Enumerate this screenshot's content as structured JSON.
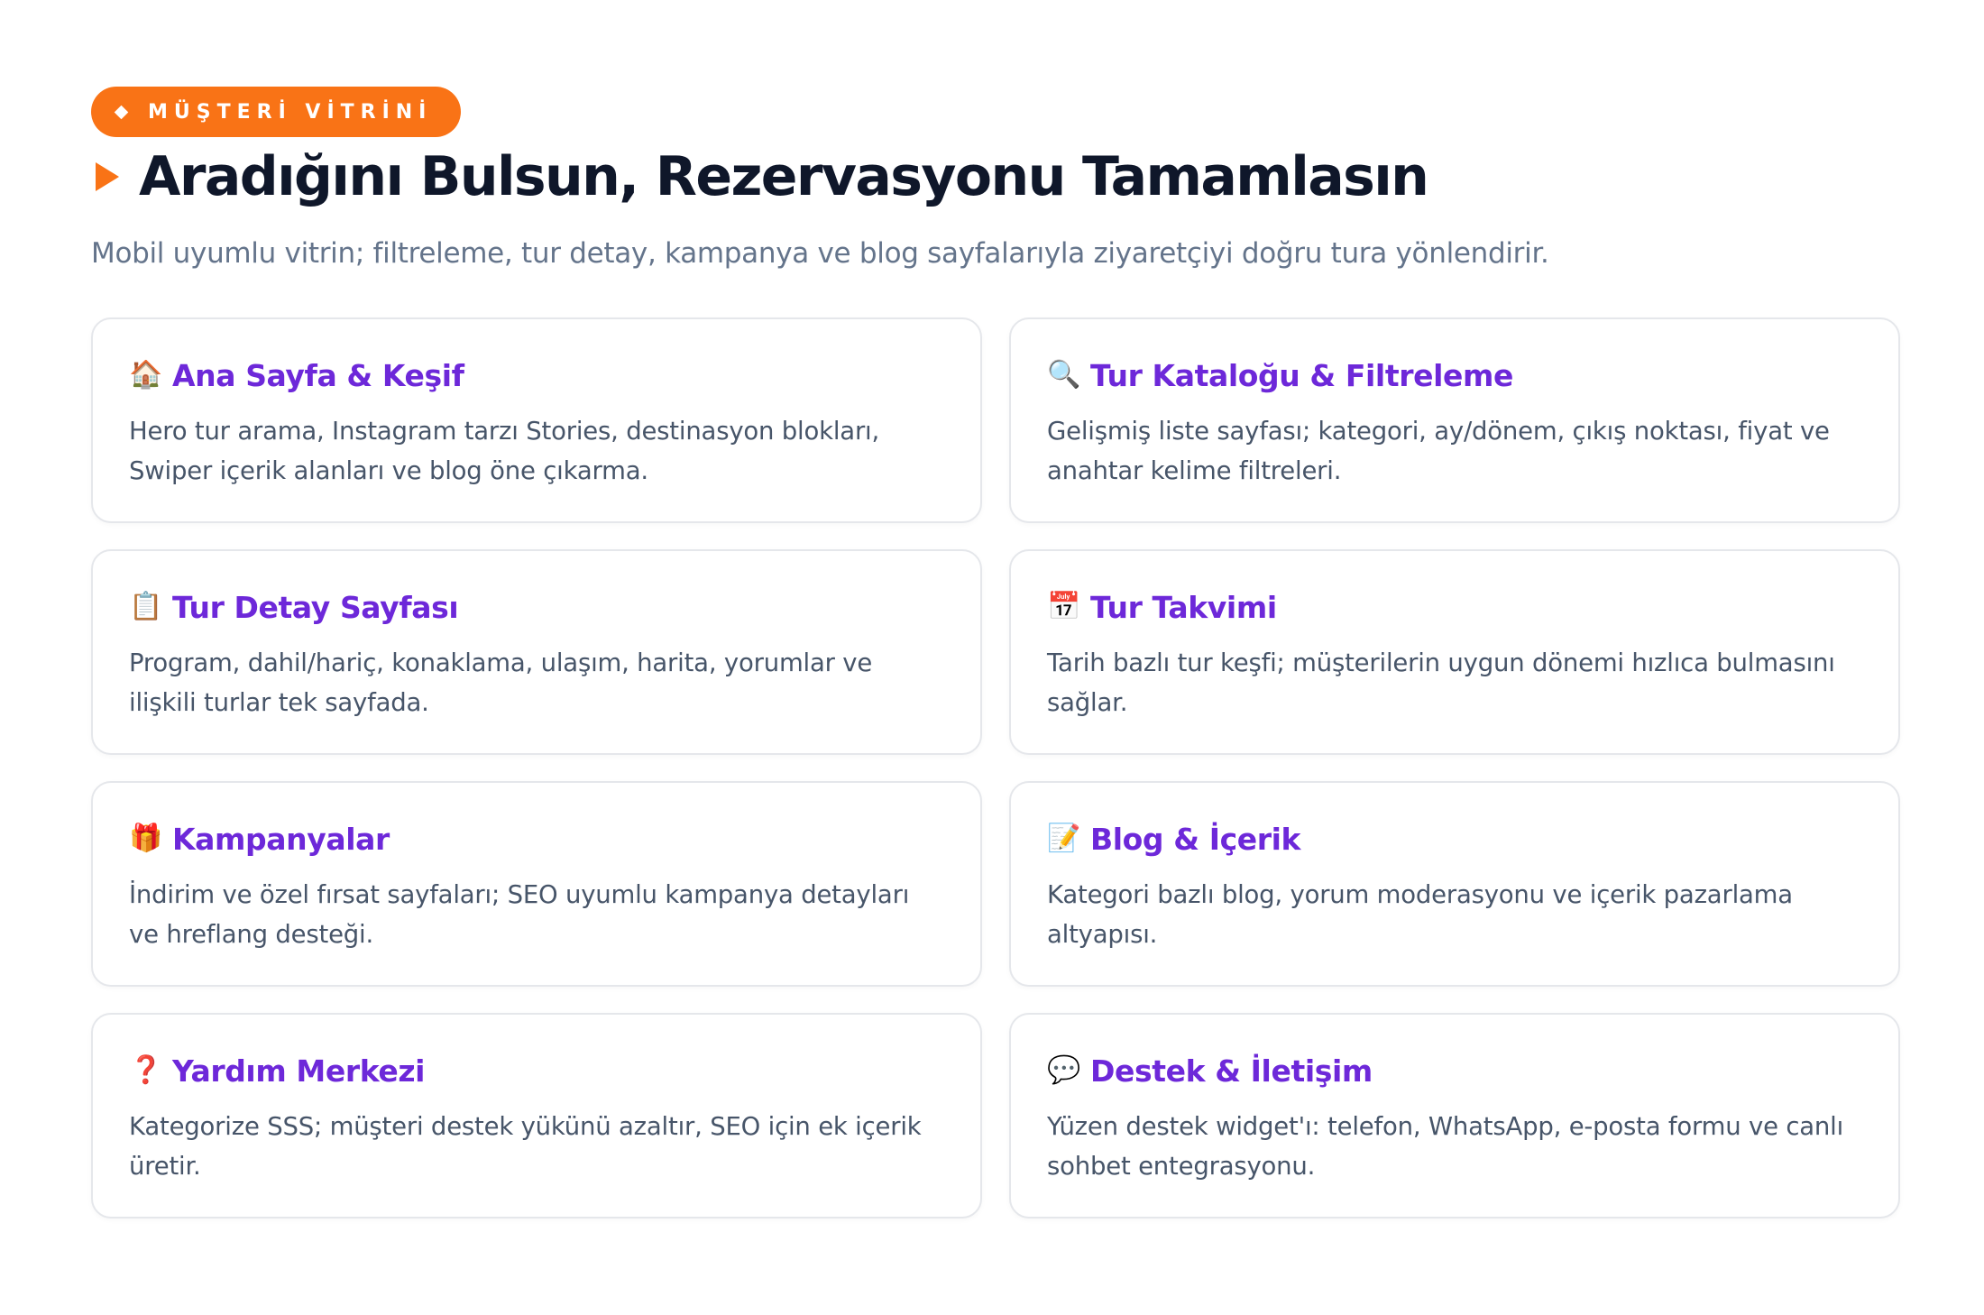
{
  "badge": {
    "label": "MÜŞTERİ VİTRİNİ"
  },
  "header": {
    "title": "Aradığını Bulsun, Rezervasyonu Tamamlasın",
    "subtitle": "Mobil uyumlu vitrin; filtreleme, tur detay, kampanya ve blog sayfalarıyla ziyaretçiyi doğru tura yönlendirir."
  },
  "colors": {
    "accent": "#f97316",
    "card_title": "#6d28d9",
    "title": "#0f172a",
    "subtitle": "#64748b",
    "body": "#475569",
    "card_border": "#e5e7eb"
  },
  "cards": [
    {
      "icon": "house-icon",
      "glyph": "🏠",
      "title": "Ana Sayfa & Keşif",
      "desc": "Hero tur arama, Instagram tarzı Stories, destinasyon blokları, Swiper içerik alanları ve blog öne çıkarma."
    },
    {
      "icon": "magnifier-icon",
      "glyph": "🔍",
      "title": "Tur Kataloğu & Filtreleme",
      "desc": "Gelişmiş liste sayfası; kategori, ay/dönem, çıkış noktası, fiyat ve anahtar kelime filtreleri."
    },
    {
      "icon": "clipboard-icon",
      "glyph": "📋",
      "title": "Tur Detay Sayfası",
      "desc": "Program, dahil/hariç, konaklama, ulaşım, harita, yorumlar ve ilişkili turlar tek sayfada."
    },
    {
      "icon": "calendar-icon",
      "glyph": "📅",
      "title": "Tur Takvimi",
      "desc": "Tarih bazlı tur keşfi; müşterilerin uygun dönemi hızlıca bulmasını sağlar."
    },
    {
      "icon": "gift-icon",
      "glyph": "🎁",
      "title": "Kampanyalar",
      "desc": "İndirim ve özel fırsat sayfaları; SEO uyumlu kampanya detayları ve hreflang desteği."
    },
    {
      "icon": "memo-icon",
      "glyph": "📝",
      "title": "Blog & İçerik",
      "desc": "Kategori bazlı blog, yorum moderasyonu ve içerik pazarlama altyapısı."
    },
    {
      "icon": "question-mark-icon",
      "glyph": "❓",
      "title": "Yardım Merkezi",
      "desc": "Kategorize SSS; müşteri destek yükünü azaltır, SEO için ek içerik üretir."
    },
    {
      "icon": "speech-bubble-icon",
      "glyph": "💬",
      "title": "Destek & İletişim",
      "desc": "Yüzen destek widget'ı: telefon, WhatsApp, e-posta formu ve canlı sohbet entegrasyonu."
    }
  ]
}
